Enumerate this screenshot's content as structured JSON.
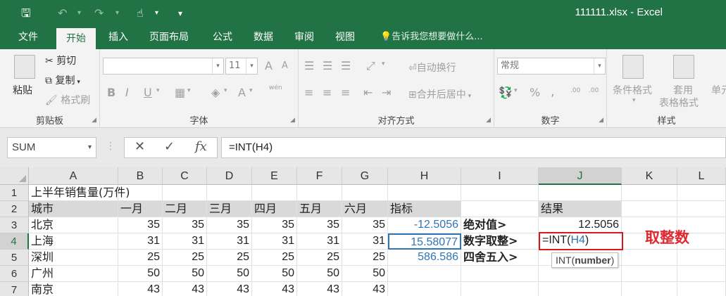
{
  "window": {
    "title": "111111.xlsx - Excel",
    "quick_access": {
      "save": "🖫",
      "undo": "↶",
      "redo": "↷",
      "touch": "☝",
      "more": "▾"
    }
  },
  "tabs": [
    "文件",
    "开始",
    "插入",
    "页面布局",
    "公式",
    "数据",
    "审阅",
    "视图"
  ],
  "active_tab": "开始",
  "search_hint": "告诉我您想要做什么...",
  "ribbon": {
    "clipboard": {
      "label": "剪贴板",
      "paste": "粘贴",
      "cut": "剪切",
      "copy": "复制",
      "format_painter": "格式刷"
    },
    "font": {
      "label": "字体",
      "size": "11",
      "bold": "B",
      "italic": "I",
      "underline": "U",
      "grow": "A",
      "shrink": "A",
      "color_a": "A",
      "phonetic": "wén"
    },
    "alignment": {
      "label": "对齐方式",
      "wrap_text": "自动换行",
      "merge_center": "合并后居中"
    },
    "number": {
      "label": "数字",
      "format": "常规",
      "percent": "%",
      "comma": ",",
      "inc_decimal": ".00",
      "dec_decimal": ".00"
    },
    "styles": {
      "label": "样式",
      "conditional": "条件格式",
      "table_format": "套用",
      "table_format2": "表格格式",
      "cell_styles": "单元"
    }
  },
  "formula_bar": {
    "name_box": "SUM",
    "cancel": "✕",
    "enter": "✓",
    "fx": "fx",
    "formula": "=INT(H4)"
  },
  "columns": [
    "A",
    "B",
    "C",
    "D",
    "E",
    "F",
    "G",
    "H",
    "I",
    "J",
    "K",
    "L"
  ],
  "rows": [
    "1",
    "2",
    "3",
    "4",
    "5",
    "6",
    "7"
  ],
  "sheet": {
    "title": "上半年销售量(万件)",
    "headers": [
      "城市",
      "一月",
      "二月",
      "三月",
      "四月",
      "五月",
      "六月"
    ],
    "data": [
      [
        "北京",
        "35",
        "35",
        "35",
        "35",
        "35",
        "35"
      ],
      [
        "上海",
        "31",
        "31",
        "31",
        "31",
        "31",
        "31"
      ],
      [
        "深圳",
        "25",
        "25",
        "25",
        "25",
        "25",
        "25"
      ],
      [
        "广州",
        "50",
        "50",
        "50",
        "50",
        "50",
        "50"
      ],
      [
        "南京",
        "43",
        "43",
        "43",
        "43",
        "43",
        "43"
      ]
    ],
    "indicator_header": "指标",
    "indicators": [
      "-12.5056",
      "15.58077",
      "586.586"
    ],
    "labels": [
      "绝对值>",
      "数字取整>",
      "四舍五入>"
    ],
    "result_header": "结果",
    "result_abs": "12.5056",
    "editing_prefix": "=INT(",
    "editing_ref": "H4",
    "editing_suffix": ")",
    "tooltip_func": "INT(",
    "tooltip_arg": "number",
    "tooltip_end": ")",
    "annotation": "取整数"
  }
}
